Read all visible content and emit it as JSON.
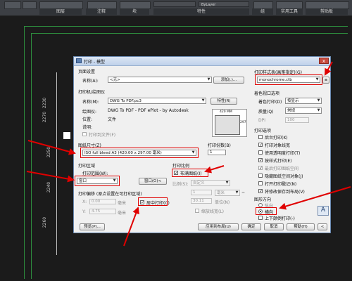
{
  "ribbon": {
    "labels": [
      "图层",
      "注释",
      "块",
      "特性",
      "组",
      "实用工具",
      "剪贴板"
    ],
    "linetype_combo": "ByLayer"
  },
  "drawing": {
    "dims": [
      "2270",
      "2230",
      "2250",
      "2240",
      "2260"
    ]
  },
  "dialog": {
    "title": "打印 - 模型",
    "close_glyph": "x",
    "page_setup": {
      "header": "页面设置",
      "name_label": "名称(A):",
      "name_value": "<无>",
      "add_button": "添加(.)..."
    },
    "printer": {
      "header": "打印机/绘图仪",
      "name_label": "名称(M):",
      "name_value": "DWG To PDF.pc3",
      "properties_button": "特性(R)",
      "plotter_label": "绘图仪:",
      "plotter_value": "DWG To PDF - PDF ePlot - by Autodesk",
      "location_label": "位置:",
      "location_value": "文件",
      "desc_label": "说明:",
      "to_file_label": "打印到文件(F)",
      "preview_dim_top": "420 MM",
      "preview_dim_side": "297"
    },
    "paper_size": {
      "header": "图纸尺寸(Z)",
      "value": "ISO full bleed A3 (420.00 x 297.00 毫米)"
    },
    "copies": {
      "header": "打印份数(B)",
      "value": "1"
    },
    "plot_area": {
      "header": "打印区域",
      "range_label": "打印范围(W):",
      "range_value": "窗口",
      "window_button": "窗口(O)<"
    },
    "plot_scale": {
      "header": "打印比例",
      "fit_label": "布满图纸(I)",
      "fit_checked": "✓",
      "scale_label": "比例(S):",
      "scale_value": "自定义",
      "num_value": "1",
      "unit_value": "毫米",
      "eq": "=",
      "unit2_value": "30.11",
      "unit2_label": "单位(N)",
      "lineweights_label": "缩放线宽(L)"
    },
    "plot_offset": {
      "header": "打印偏移 (原点设置在可打印区域)",
      "x_label": "X:",
      "x_value": "0.00",
      "x_unit": "毫米",
      "y_label": "Y:",
      "y_value": "4.75",
      "y_unit": "毫米",
      "center_label": "居中打印(C)",
      "center_checked": "✓"
    },
    "style_table": {
      "header": "打印样式表(画笔指定)(G)",
      "value": "monochrome.ctb",
      "edit_glyph": "≡"
    },
    "shaded": {
      "header": "着色视口选项",
      "shade_label": "着色打印(D)",
      "shade_value": "按显示",
      "quality_label": "质量(Q)",
      "quality_value": "常规",
      "dpi_label": "DPI",
      "dpi_value": "100"
    },
    "options": {
      "header": "打印选项",
      "items": [
        {
          "label": "后台打印(K)",
          "checked": ""
        },
        {
          "label": "打印对象线宽",
          "checked": "✓"
        },
        {
          "label": "使用透明度打印(T)",
          "checked": ""
        },
        {
          "label": "按样式打印(E)",
          "checked": "✓"
        },
        {
          "label": "最后打印图纸空间",
          "checked": "✓"
        },
        {
          "label": "隐藏图纸空间对象(J)",
          "checked": ""
        },
        {
          "label": "打开打印戳记(N)",
          "checked": ""
        },
        {
          "label": "将修改保存到布局(V)",
          "checked": "✓"
        }
      ]
    },
    "orientation": {
      "header": "图形方向",
      "portrait": "纵向",
      "landscape": "横向",
      "upside_down": "上下颠倒打印(-)",
      "page_glyph": "A"
    },
    "buttons": {
      "preview": "预览(P)...",
      "apply": "应用到布局(U)",
      "ok": "确定",
      "cancel": "取消",
      "help": "帮助(H)",
      "more_glyph": "<"
    }
  },
  "colors": {
    "highlight": "#e00000",
    "dialog_bg": "#f0f0f0",
    "titlebar": "#bfd1ea",
    "drawing_line": "#2d8f3e"
  }
}
